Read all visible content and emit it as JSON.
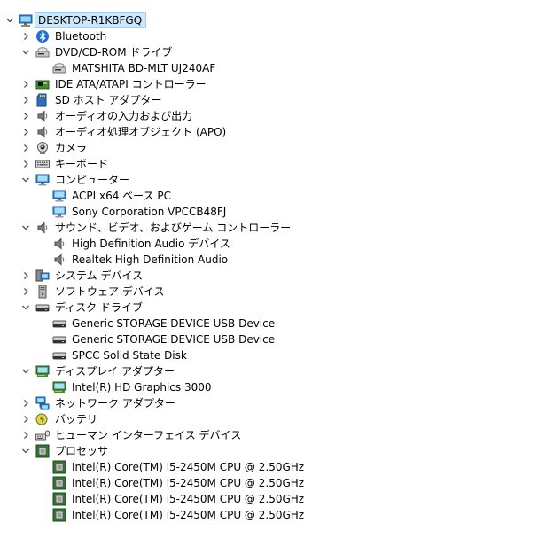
{
  "tree": {
    "root": {
      "label": "DESKTOP-R1KBFGQ",
      "icon": "computer-icon"
    },
    "rows": [
      {
        "id": "bluetooth",
        "label": "Bluetooth",
        "depth": 1,
        "icon": "bluetooth-icon",
        "expanded": false
      },
      {
        "id": "dvd-drives",
        "label": "DVD/CD-ROM ドライブ",
        "depth": 1,
        "icon": "dvd-drive-icon",
        "expanded": true
      },
      {
        "id": "dvd-matshita",
        "label": "MATSHITA BD-MLT UJ240AF",
        "depth": 2,
        "icon": "dvd-drive-icon"
      },
      {
        "id": "ide-ata",
        "label": "IDE ATA/ATAPI コントローラー",
        "depth": 1,
        "icon": "ide-controller-icon",
        "expanded": false
      },
      {
        "id": "sd-host",
        "label": "SD ホスト アダプター",
        "depth": 1,
        "icon": "sd-card-icon",
        "expanded": false
      },
      {
        "id": "audio-io",
        "label": "オーディオの入力および出力",
        "depth": 1,
        "icon": "speaker-icon",
        "expanded": false
      },
      {
        "id": "apo",
        "label": "オーディオ処理オブジェクト (APO)",
        "depth": 1,
        "icon": "speaker-icon",
        "expanded": false
      },
      {
        "id": "camera",
        "label": "カメラ",
        "depth": 1,
        "icon": "camera-icon",
        "expanded": false
      },
      {
        "id": "keyboard",
        "label": "キーボード",
        "depth": 1,
        "icon": "keyboard-icon",
        "expanded": false
      },
      {
        "id": "computer",
        "label": "コンピューター",
        "depth": 1,
        "icon": "monitor-icon",
        "expanded": true
      },
      {
        "id": "acpi",
        "label": "ACPI x64 ベース PC",
        "depth": 2,
        "icon": "monitor-icon"
      },
      {
        "id": "sony",
        "label": "Sony Corporation VPCCB48FJ",
        "depth": 2,
        "icon": "monitor-icon"
      },
      {
        "id": "sound",
        "label": "サウンド、ビデオ、およびゲーム コントローラー",
        "depth": 1,
        "icon": "speaker-icon",
        "expanded": true
      },
      {
        "id": "hd-audio",
        "label": "High Definition Audio デバイス",
        "depth": 2,
        "icon": "speaker-icon"
      },
      {
        "id": "realtek",
        "label": "Realtek High Definition Audio",
        "depth": 2,
        "icon": "speaker-icon"
      },
      {
        "id": "system-devices",
        "label": "システム デバイス",
        "depth": 1,
        "icon": "system-devices-icon",
        "expanded": false
      },
      {
        "id": "software-devices",
        "label": "ソフトウェア デバイス",
        "depth": 1,
        "icon": "software-device-icon",
        "expanded": false
      },
      {
        "id": "disk-drives",
        "label": "ディスク ドライブ",
        "depth": 1,
        "icon": "disk-drive-icon",
        "expanded": true
      },
      {
        "id": "disk-1",
        "label": "Generic STORAGE DEVICE USB Device",
        "depth": 2,
        "icon": "disk-drive-icon"
      },
      {
        "id": "disk-2",
        "label": "Generic STORAGE DEVICE USB Device",
        "depth": 2,
        "icon": "disk-drive-icon"
      },
      {
        "id": "disk-3",
        "label": "SPCC Solid State Disk",
        "depth": 2,
        "icon": "disk-drive-icon"
      },
      {
        "id": "display-adapters",
        "label": "ディスプレイ アダプター",
        "depth": 1,
        "icon": "display-adapter-icon",
        "expanded": true
      },
      {
        "id": "intel-hd",
        "label": "Intel(R) HD Graphics 3000",
        "depth": 2,
        "icon": "display-adapter-icon"
      },
      {
        "id": "network",
        "label": "ネットワーク アダプター",
        "depth": 1,
        "icon": "network-icon",
        "expanded": false
      },
      {
        "id": "battery",
        "label": "バッテリ",
        "depth": 1,
        "icon": "battery-icon",
        "expanded": false
      },
      {
        "id": "hid",
        "label": "ヒューマン インターフェイス デバイス",
        "depth": 1,
        "icon": "hid-icon",
        "expanded": false
      },
      {
        "id": "processors",
        "label": "プロセッサ",
        "depth": 1,
        "icon": "processor-icon",
        "expanded": true
      },
      {
        "id": "cpu-1",
        "label": "Intel(R) Core(TM) i5-2450M CPU @ 2.50GHz",
        "depth": 2,
        "icon": "processor-icon"
      },
      {
        "id": "cpu-2",
        "label": "Intel(R) Core(TM) i5-2450M CPU @ 2.50GHz",
        "depth": 2,
        "icon": "processor-icon"
      },
      {
        "id": "cpu-3",
        "label": "Intel(R) Core(TM) i5-2450M CPU @ 2.50GHz",
        "depth": 2,
        "icon": "processor-icon"
      },
      {
        "id": "cpu-4",
        "label": "Intel(R) Core(TM) i5-2450M CPU @ 2.50GHz",
        "depth": 2,
        "icon": "processor-icon"
      }
    ]
  },
  "colors": {
    "selection_bg": "#cce8ff",
    "selection_border": "#99d1ff",
    "chevron": "#555555"
  }
}
